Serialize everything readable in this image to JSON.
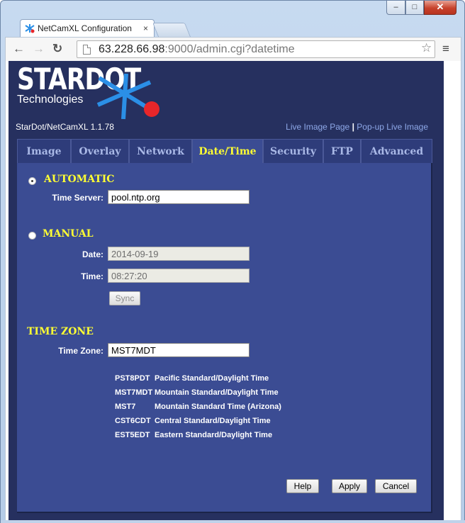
{
  "browser": {
    "tab_title": "NetCamXL Configuration",
    "tab_close": "×",
    "url_host": "63.228.66.98",
    "url_path": ":9000/admin.cgi?datetime"
  },
  "header": {
    "logo_text": "STARDOT",
    "logo_sub": "Technologies",
    "version": "StarDot/NetCamXL 1.1.78",
    "link_live": "Live Image Page",
    "link_sep": "|",
    "link_popup": "Pop-up Live Image"
  },
  "tabs": [
    {
      "label": "Image"
    },
    {
      "label": "Overlay"
    },
    {
      "label": "Network"
    },
    {
      "label": "Date/Time"
    },
    {
      "label": "Security"
    },
    {
      "label": "FTP"
    },
    {
      "label": "Advanced"
    }
  ],
  "automatic": {
    "heading": "AUTOMATIC",
    "time_server_label": "Time Server:",
    "time_server_value": "pool.ntp.org"
  },
  "manual": {
    "heading": "MANUAL",
    "date_label": "Date:",
    "date_value": "2014-09-19",
    "time_label": "Time:",
    "time_value": "08:27:20",
    "sync_label": "Sync"
  },
  "timezone": {
    "heading": "TIME ZONE",
    "label": "Time Zone:",
    "value": "MST7MDT",
    "list": [
      {
        "code": "PST8PDT",
        "desc": "Pacific Standard/Daylight Time"
      },
      {
        "code": "MST7MDT",
        "desc": "Mountain Standard/Daylight Time"
      },
      {
        "code": "MST7",
        "desc": "Mountain Standard Time (Arizona)"
      },
      {
        "code": "CST6CDT",
        "desc": "Central Standard/Daylight Time"
      },
      {
        "code": "EST5EDT",
        "desc": "Eastern Standard/Daylight Time"
      }
    ]
  },
  "actions": {
    "help": "Help",
    "apply": "Apply",
    "cancel": "Cancel"
  },
  "colors": {
    "page_bg": "#26305f",
    "panel_bg": "#3b4c93",
    "heading": "#ffff33",
    "star_blue": "#2b8fe6",
    "star_red": "#e8262a"
  }
}
